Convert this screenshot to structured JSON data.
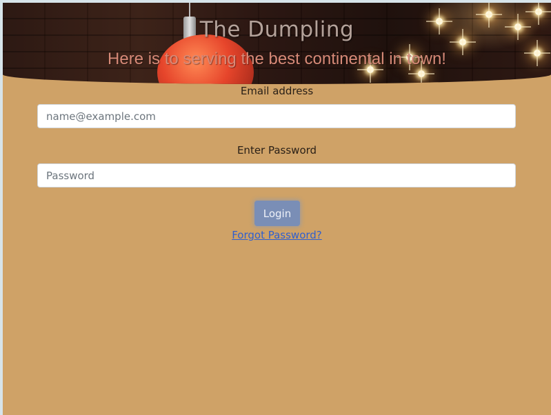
{
  "banner": {
    "title": "The Dumpling",
    "subtitle": "Here is to serving the best continental in town!"
  },
  "form": {
    "email": {
      "label": "Email address",
      "placeholder": "name@example.com",
      "value": ""
    },
    "password": {
      "label": "Enter Password",
      "placeholder": "Password",
      "value": ""
    },
    "login_label": "Login",
    "forgot_label": "Forgot Password?"
  },
  "colors": {
    "page_background": "#cfa267",
    "login_button": "#7a8eb6",
    "link": "#2f5fcf"
  }
}
